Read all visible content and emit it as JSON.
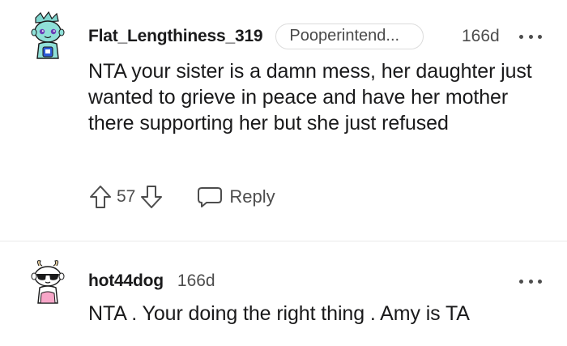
{
  "comments": [
    {
      "username": "Flat_Lengthiness_319",
      "flair": "Pooperintend...",
      "time": "166d",
      "text": "NTA your sister is a damn mess, her daughter just wanted to grieve in peace and have her mother there supporting her but she just refused",
      "votes": "57",
      "reply_label": "Reply",
      "avatar_icon": "snoo-avatar-teal-icon"
    },
    {
      "username": "hot44dog",
      "time": "166d",
      "text": "NTA . Your doing the right thing . Amy is TA",
      "avatar_icon": "snoo-avatar-sunglasses-icon"
    }
  ],
  "colors": {
    "text": "#1a1a1b",
    "meta": "#4d4d4d",
    "divider": "#e9e9e9",
    "flair_border": "#dcdcdc"
  },
  "icons": {
    "upvote": "arrow-up-icon",
    "downvote": "arrow-down-icon",
    "reply": "speech-bubble-icon",
    "more": "more-options-icon"
  }
}
